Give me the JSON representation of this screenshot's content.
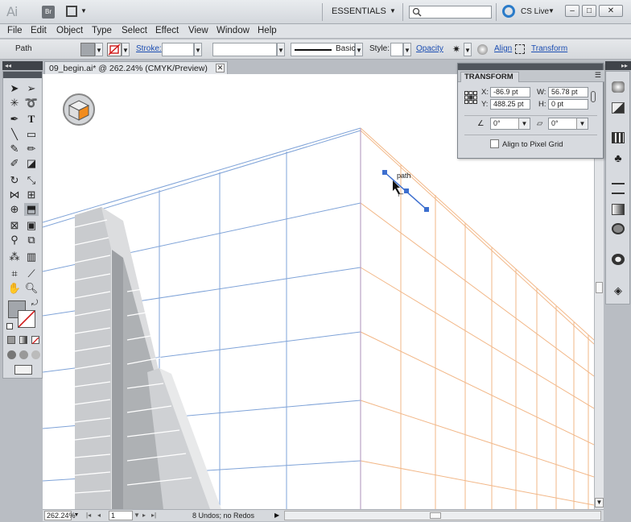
{
  "app": {
    "logo_text": "Ai",
    "bridge_label": "Br",
    "workspace": "ESSENTIALS",
    "search_placeholder": "",
    "cs_live": "CS Live"
  },
  "window_buttons": [
    "–",
    "□",
    "✕"
  ],
  "menu": [
    "File",
    "Edit",
    "Object",
    "Type",
    "Select",
    "Effect",
    "View",
    "Window",
    "Help"
  ],
  "control_bar": {
    "selection_label": "Path",
    "stroke_label": "Stroke:",
    "stroke_value": "",
    "brush_label": "Basic",
    "style_label": "Style:",
    "opacity_link": "Opacity",
    "align_link": "Align",
    "transform_link": "Transform"
  },
  "document": {
    "tab_title": "09_begin.ai* @ 262.24% (CMYK/Preview)",
    "close_glyph": "✕"
  },
  "canvas": {
    "path_label": "path",
    "colors": {
      "left_grid": "#7fa3d8",
      "right_grid": "#f2b787",
      "selection": "#3d6fcf",
      "path_label": "#5cd15c"
    }
  },
  "status_bar": {
    "zoom": "262.24%",
    "page": "1",
    "info": "8 Undos; no Redos"
  },
  "transform_panel": {
    "title": "TRANSFORM",
    "x_label": "X:",
    "x_value": "-86.9 pt",
    "y_label": "Y:",
    "y_value": "488.25 pt",
    "w_label": "W:",
    "w_value": "56.78 pt",
    "h_label": "H:",
    "h_value": "0 pt",
    "rotate_value": "0°",
    "shear_value": "0°",
    "pixel_grid_label": "Align to Pixel Grid"
  }
}
